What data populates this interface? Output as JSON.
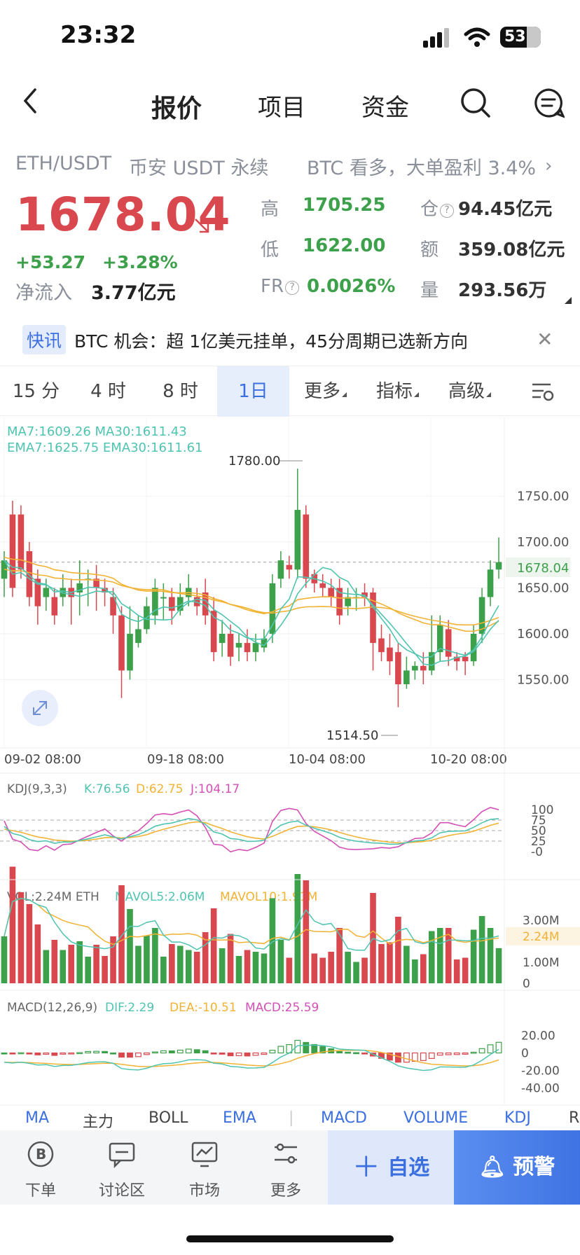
{
  "status_bar": {
    "time": "23:32",
    "battery": "53"
  },
  "nav": {
    "tabs": [
      "报价",
      "项目",
      "资金"
    ]
  },
  "ticker": {
    "pair": "ETH/USDT",
    "exchange": "币安 USDT 永续",
    "news_teaser": "BTC 看多，大单盈利 3.4%",
    "price": "1678.04",
    "change_abs": "+53.27",
    "change_pct": "+3.28%",
    "inflow_label": "净流入",
    "inflow_value": "3.77亿元",
    "high_label": "高",
    "high": "1705.25",
    "low_label": "低",
    "low": "1622.00",
    "fr_label": "FR",
    "fr": "0.0026%",
    "oi_label": "仓",
    "oi": "94.45亿元",
    "amount_label": "额",
    "amount": "359.08亿元",
    "volume_label": "量",
    "volume": "293.56万"
  },
  "flash": {
    "tag": "快讯",
    "text": "BTC 机会：超 1亿美元挂单，45分周期已选新方向"
  },
  "timeframes": {
    "items": [
      "15 分",
      "4 时",
      "8 时",
      "1日",
      "更多",
      "指标",
      "高级"
    ],
    "active": "1日"
  },
  "main_chart": {
    "legend_ma": "MA7:1609.26  MA30:1611.43",
    "legend_ema": "EMA7:1625.75  EMA30:1611.61",
    "high_marker": "1780.00",
    "low_marker": "1514.50",
    "price_tag": "1678.04",
    "y_ticks": [
      "1750.00",
      "1700.00",
      "1650.00",
      "1600.00",
      "1550.00"
    ],
    "x_ticks": [
      "09-02 08:00",
      "09-18 08:00",
      "10-04 08:00",
      "10-20 08:00"
    ]
  },
  "kdj": {
    "legend_name": "KDJ(9,3,3)",
    "k": "K:76.56",
    "d": "D:62.75",
    "j": "J:104.17",
    "y_ticks": [
      "100",
      "75",
      "50",
      "25",
      "-0"
    ]
  },
  "vol": {
    "legend_name": "VOL:2.24M ETH",
    "mavol5": "MAVOL5:2.06M",
    "mavol10": "MAVOL10:1.91M",
    "y_ticks": [
      "3.00M",
      "1.00M",
      "0"
    ],
    "tag": "2.24M"
  },
  "macd": {
    "legend_name": "MACD(12,26,9)",
    "dif": "DIF:2.29",
    "dea": "DEA:-10.51",
    "macd": "MACD:25.59",
    "y_ticks": [
      "20.00",
      "0",
      "-20.00",
      "-40.00"
    ]
  },
  "indicator_tabs": [
    "MA",
    "主力",
    "BOLL",
    "EMA",
    "MACD",
    "VOLUME",
    "KDJ",
    "R"
  ],
  "bottom_nav": {
    "items": [
      "下单",
      "讨论区",
      "市场",
      "更多"
    ],
    "fav": "自选",
    "alert": "预警"
  },
  "colors": {
    "up": "#3da04a",
    "down": "#d9484e",
    "accent": "#3b6fe0",
    "ma7": "#4fc4b0",
    "ma30": "#f2b233",
    "j_line": "#d44fb6"
  },
  "chart_data": {
    "type": "candlestick",
    "x_tick_labels": [
      "09-02 08:00",
      "09-18 08:00",
      "10-04 08:00",
      "10-20 08:00"
    ],
    "ylim": [
      1500,
      1790
    ],
    "candles": [
      [
        1660,
        1680,
        1640,
        1690
      ],
      [
        1730,
        1650,
        1640,
        1745
      ],
      [
        1730,
        1670,
        1660,
        1740
      ],
      [
        1690,
        1640,
        1630,
        1700
      ],
      [
        1660,
        1630,
        1610,
        1670
      ],
      [
        1640,
        1650,
        1625,
        1660
      ],
      [
        1640,
        1620,
        1610,
        1650
      ],
      [
        1640,
        1650,
        1630,
        1665
      ],
      [
        1650,
        1640,
        1610,
        1660
      ],
      [
        1645,
        1655,
        1620,
        1680
      ],
      [
        1660,
        1660,
        1630,
        1670
      ],
      [
        1660,
        1650,
        1625,
        1675
      ],
      [
        1650,
        1645,
        1630,
        1660
      ],
      [
        1640,
        1620,
        1600,
        1650
      ],
      [
        1620,
        1560,
        1530,
        1630
      ],
      [
        1560,
        1600,
        1550,
        1630
      ],
      [
        1590,
        1605,
        1585,
        1620
      ],
      [
        1605,
        1630,
        1600,
        1640
      ],
      [
        1620,
        1650,
        1610,
        1660
      ],
      [
        1640,
        1640,
        1615,
        1655
      ],
      [
        1640,
        1625,
        1610,
        1650
      ],
      [
        1625,
        1640,
        1620,
        1655
      ],
      [
        1640,
        1650,
        1630,
        1665
      ],
      [
        1640,
        1630,
        1620,
        1650
      ],
      [
        1645,
        1620,
        1610,
        1660
      ],
      [
        1625,
        1580,
        1570,
        1640
      ],
      [
        1590,
        1600,
        1575,
        1615
      ],
      [
        1600,
        1575,
        1565,
        1610
      ],
      [
        1585,
        1590,
        1570,
        1600
      ],
      [
        1590,
        1580,
        1570,
        1605
      ],
      [
        1580,
        1590,
        1570,
        1600
      ],
      [
        1585,
        1595,
        1580,
        1605
      ],
      [
        1600,
        1655,
        1590,
        1665
      ],
      [
        1660,
        1680,
        1650,
        1690
      ],
      [
        1675,
        1670,
        1660,
        1685
      ],
      [
        1670,
        1735,
        1660,
        1780
      ],
      [
        1730,
        1660,
        1650,
        1740
      ],
      [
        1665,
        1655,
        1645,
        1670
      ],
      [
        1655,
        1650,
        1640,
        1665
      ],
      [
        1650,
        1640,
        1630,
        1660
      ],
      [
        1650,
        1620,
        1610,
        1660
      ],
      [
        1630,
        1640,
        1620,
        1650
      ],
      [
        1640,
        1640,
        1625,
        1650
      ],
      [
        1645,
        1640,
        1630,
        1655
      ],
      [
        1645,
        1590,
        1560,
        1650
      ],
      [
        1595,
        1580,
        1570,
        1610
      ],
      [
        1585,
        1570,
        1555,
        1600
      ],
      [
        1580,
        1545,
        1520,
        1590
      ],
      [
        1545,
        1560,
        1540,
        1575
      ],
      [
        1560,
        1565,
        1550,
        1570
      ],
      [
        1565,
        1560,
        1545,
        1580
      ],
      [
        1560,
        1580,
        1555,
        1620
      ],
      [
        1580,
        1610,
        1570,
        1620
      ],
      [
        1605,
        1575,
        1565,
        1615
      ],
      [
        1575,
        1570,
        1560,
        1580
      ],
      [
        1575,
        1570,
        1555,
        1580
      ],
      [
        1570,
        1600,
        1565,
        1610
      ],
      [
        1600,
        1640,
        1590,
        1650
      ],
      [
        1640,
        1670,
        1630,
        1680
      ],
      [
        1670,
        1678,
        1660,
        1705
      ]
    ]
  }
}
